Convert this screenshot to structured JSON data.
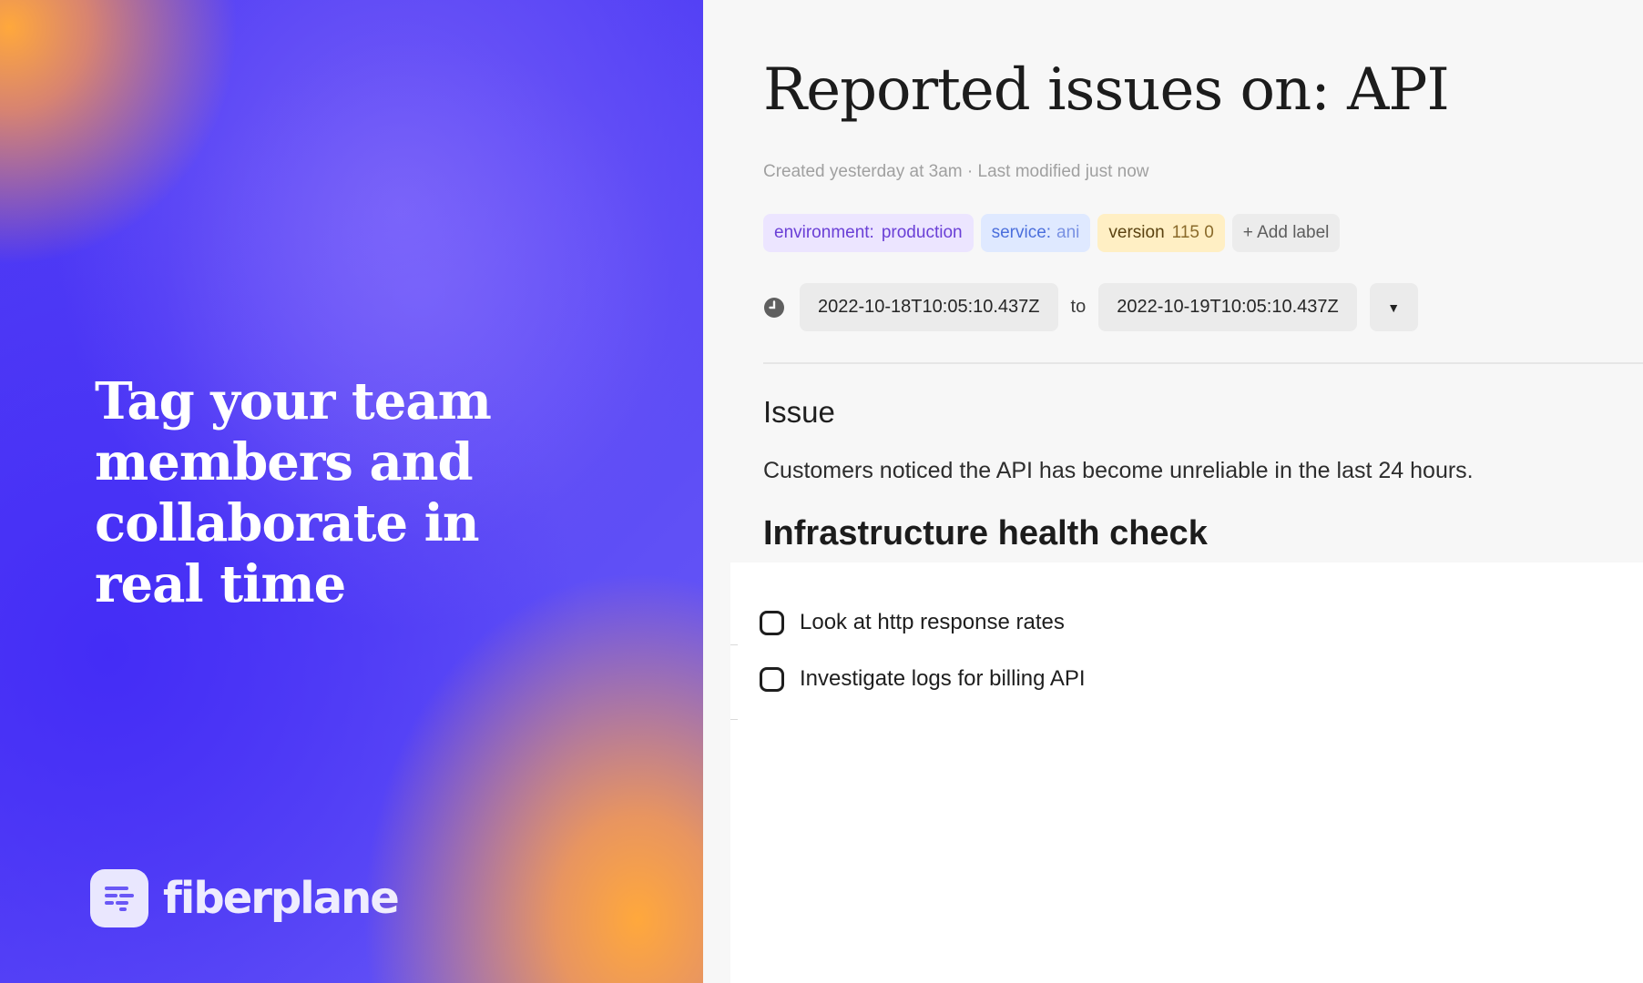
{
  "promo": {
    "headline": "Tag your team members and collaborate in real time",
    "brand_name": "fiberplane",
    "brand_icon": "fiberplane-logo-icon"
  },
  "document": {
    "title": "Reported issues on: API",
    "meta": "Created yesterday at 3am · Last modified just now",
    "labels": [
      {
        "key": "environment:",
        "value": "production",
        "color": "#ece5ff"
      },
      {
        "key": "service:",
        "value": "ani",
        "color": "#dfe9ff"
      },
      {
        "key": "version",
        "value": "115 0",
        "color": "#ffefc4"
      }
    ],
    "add_label": "+ Add label",
    "time_range": {
      "icon": "clock-icon",
      "from": "2022-10-18T10:05:10.437Z",
      "separator": "to",
      "to": "2022-10-19T10:05:10.437Z",
      "toggle": "▼"
    },
    "issue_heading": "Issue",
    "issue_text": "Customers noticed the API has become unreliable in the last 24 hours.",
    "health_heading": "Infrastructure health check",
    "tasks": [
      {
        "label": "Look at http response rates",
        "checked": false
      },
      {
        "label": "Investigate logs for billing API",
        "checked": false
      }
    ]
  },
  "colors": {
    "brand_purple": "#5340f5",
    "accent_orange": "#ffa83c"
  }
}
